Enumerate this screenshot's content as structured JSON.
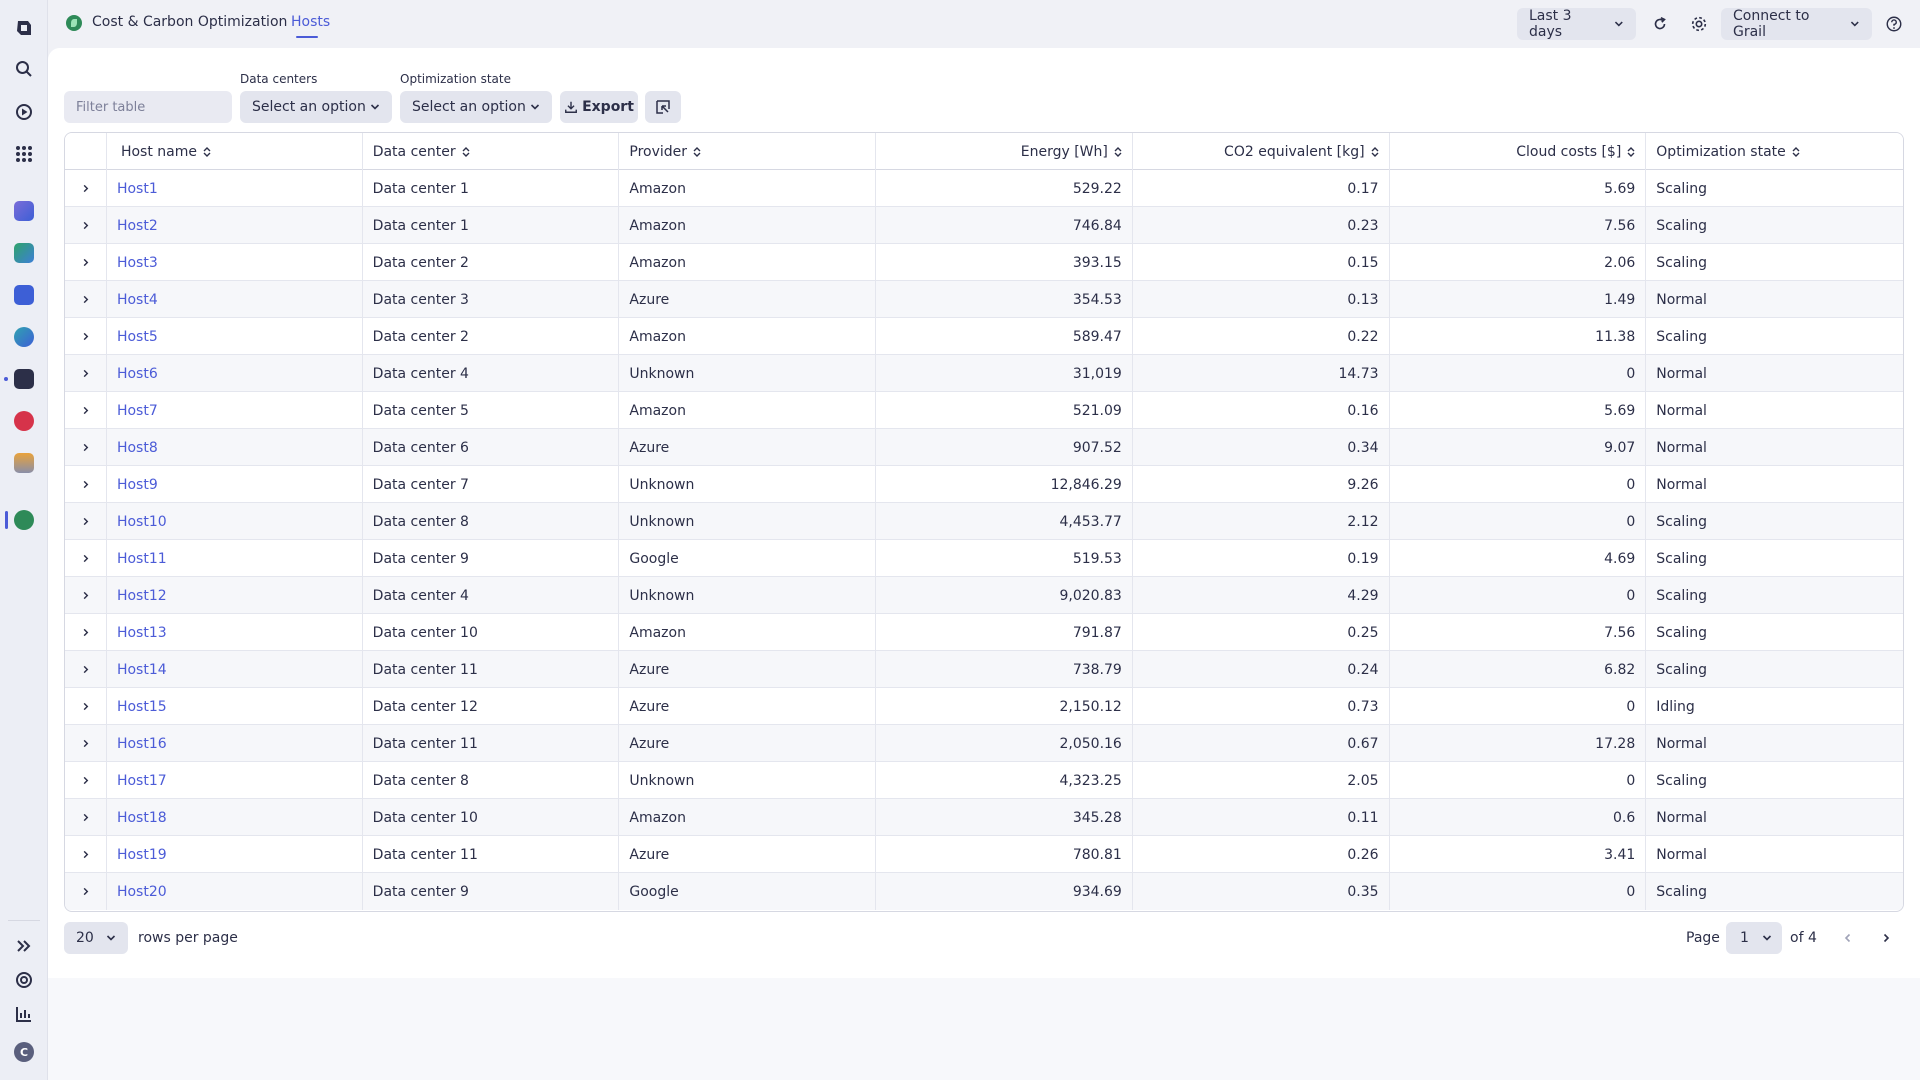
{
  "app": {
    "title": "Cost & Carbon Optimization",
    "active_tab": "Hosts"
  },
  "topbar": {
    "timeframe": "Last 3 days",
    "connect": "Connect to Grail"
  },
  "user": {
    "initial": "C"
  },
  "toolbar": {
    "filter_placeholder": "Filter table",
    "datacenters_label": "Data centers",
    "datacenters_value": "Select an option",
    "optstate_label": "Optimization state",
    "optstate_value": "Select an option",
    "export_label": "Export"
  },
  "table": {
    "headers": [
      "Host name",
      "Data center",
      "Provider",
      "Energy [Wh]",
      "CO2 equivalent [kg]",
      "Cloud costs [$]",
      "Optimization state"
    ],
    "rows": [
      [
        "Host1",
        "Data center 1",
        "Amazon",
        "529.22",
        "0.17",
        "5.69",
        "Scaling"
      ],
      [
        "Host2",
        "Data center 1",
        "Amazon",
        "746.84",
        "0.23",
        "7.56",
        "Scaling"
      ],
      [
        "Host3",
        "Data center 2",
        "Amazon",
        "393.15",
        "0.15",
        "2.06",
        "Scaling"
      ],
      [
        "Host4",
        "Data center 3",
        "Azure",
        "354.53",
        "0.13",
        "1.49",
        "Normal"
      ],
      [
        "Host5",
        "Data center 2",
        "Amazon",
        "589.47",
        "0.22",
        "11.38",
        "Scaling"
      ],
      [
        "Host6",
        "Data center 4",
        "Unknown",
        "31,019",
        "14.73",
        "0",
        "Normal"
      ],
      [
        "Host7",
        "Data center 5",
        "Amazon",
        "521.09",
        "0.16",
        "5.69",
        "Normal"
      ],
      [
        "Host8",
        "Data center 6",
        "Azure",
        "907.52",
        "0.34",
        "9.07",
        "Normal"
      ],
      [
        "Host9",
        "Data center 7",
        "Unknown",
        "12,846.29",
        "9.26",
        "0",
        "Normal"
      ],
      [
        "Host10",
        "Data center 8",
        "Unknown",
        "4,453.77",
        "2.12",
        "0",
        "Scaling"
      ],
      [
        "Host11",
        "Data center 9",
        "Google",
        "519.53",
        "0.19",
        "4.69",
        "Scaling"
      ],
      [
        "Host12",
        "Data center 4",
        "Unknown",
        "9,020.83",
        "4.29",
        "0",
        "Scaling"
      ],
      [
        "Host13",
        "Data center 10",
        "Amazon",
        "791.87",
        "0.25",
        "7.56",
        "Scaling"
      ],
      [
        "Host14",
        "Data center 11",
        "Azure",
        "738.79",
        "0.24",
        "6.82",
        "Scaling"
      ],
      [
        "Host15",
        "Data center 12",
        "Azure",
        "2,150.12",
        "0.73",
        "0",
        "Idling"
      ],
      [
        "Host16",
        "Data center 11",
        "Azure",
        "2,050.16",
        "0.67",
        "17.28",
        "Normal"
      ],
      [
        "Host17",
        "Data center 8",
        "Unknown",
        "4,323.25",
        "2.05",
        "0",
        "Scaling"
      ],
      [
        "Host18",
        "Data center 10",
        "Amazon",
        "345.28",
        "0.11",
        "0.6",
        "Normal"
      ],
      [
        "Host19",
        "Data center 11",
        "Azure",
        "780.81",
        "0.26",
        "3.41",
        "Normal"
      ],
      [
        "Host20",
        "Data center 9",
        "Google",
        "934.69",
        "0.35",
        "0",
        "Scaling"
      ]
    ]
  },
  "pagination": {
    "rows_per_page": "20",
    "rows_per_page_label": "rows per page",
    "page_label": "Page",
    "current_page": "1",
    "of_label": "of 4"
  },
  "colors": {
    "accent": "#4b5bd7",
    "app_logo": "#2e8a58"
  }
}
